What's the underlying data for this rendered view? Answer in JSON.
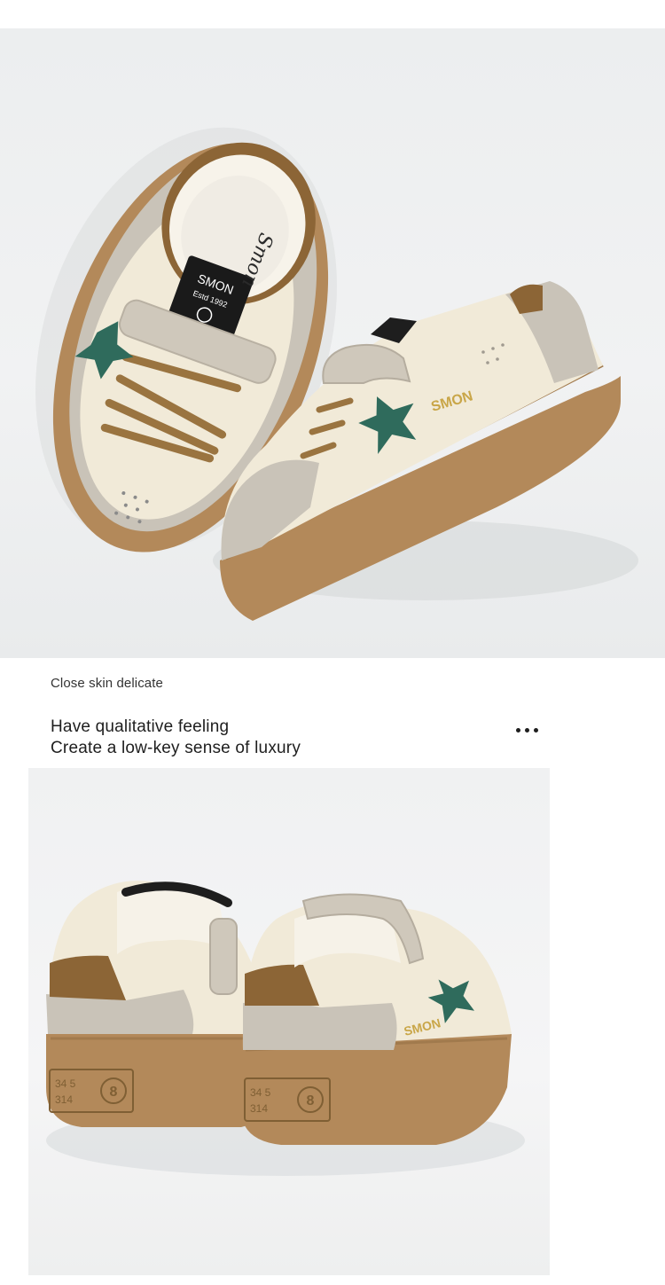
{
  "caption": {
    "small_text": "Close skin delicate",
    "headline_line1": "Have qualitative feeling",
    "headline_line2": "Create a low-key sense of luxury"
  },
  "more_icon": "more-dots-icon",
  "photos": {
    "top": {
      "brand_side": "SMON",
      "insole_script": "Smon",
      "tongue_label": "SMON",
      "tongue_sub": "Estd 1992"
    },
    "bottom": {
      "brand_side": "SMON",
      "heel_numbers_line1": "34 5",
      "heel_numbers_line2": "314",
      "heel_badge": "8"
    }
  },
  "colors": {
    "sole": "#b3895a",
    "upper": "#f1ead8",
    "suede": "#c9c3b8",
    "star": "#2f6b5c",
    "heel_tab": "#8c6536",
    "brand_gold": "#c9a648"
  }
}
